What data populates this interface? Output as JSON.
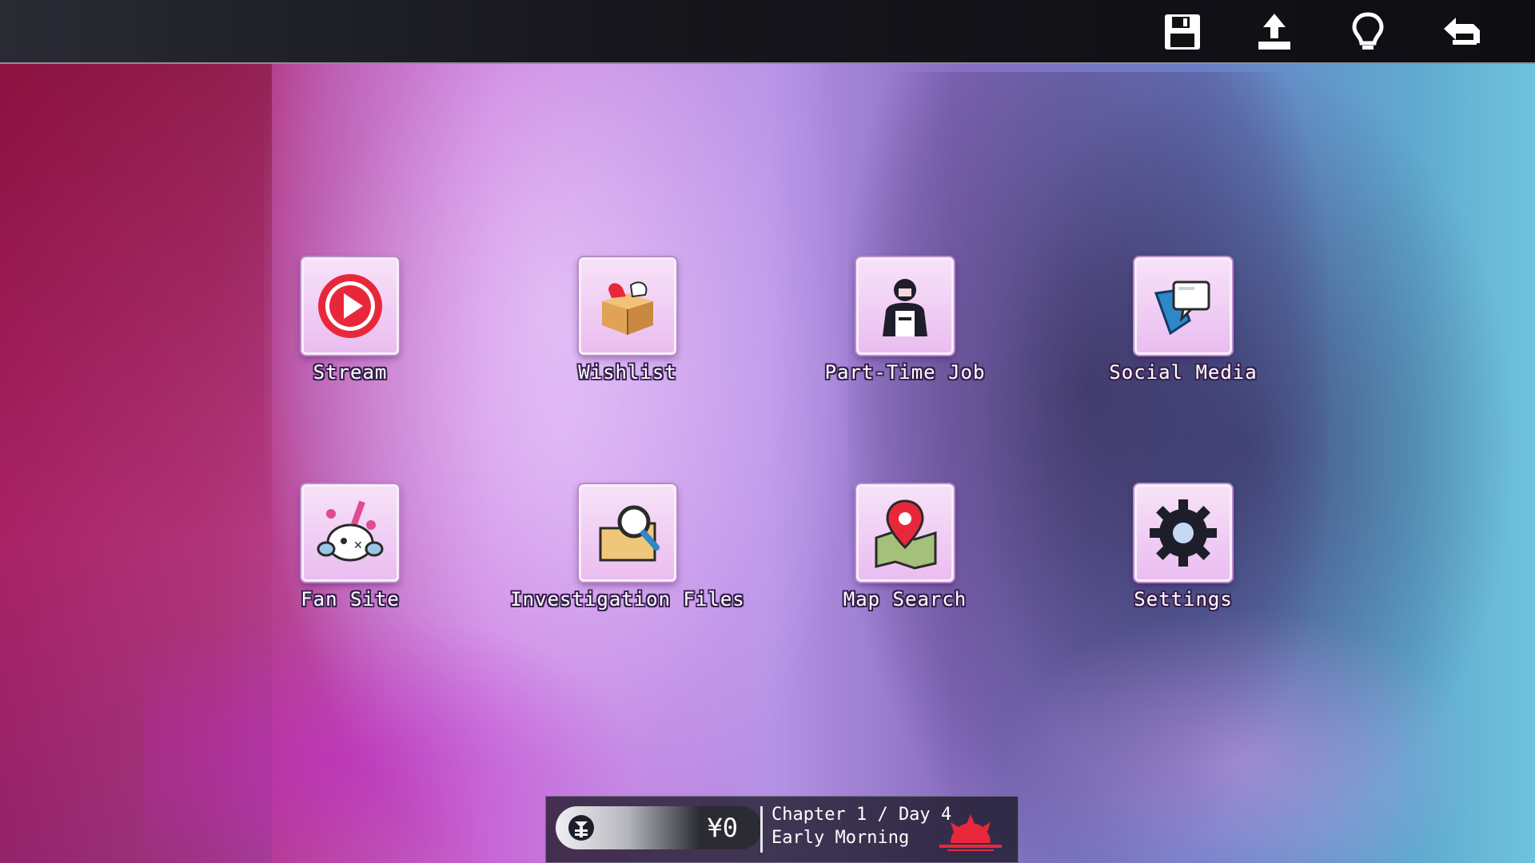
{
  "toolbar": {
    "buttons": [
      {
        "icon": "floppy-disk-icon"
      },
      {
        "icon": "upload-icon"
      },
      {
        "icon": "lightbulb-icon"
      },
      {
        "icon": "back-arrow-icon"
      }
    ]
  },
  "apps": [
    {
      "label": "Stream",
      "icon": "play-button-icon"
    },
    {
      "label": "Wishlist",
      "icon": "gift-box-icon"
    },
    {
      "label": "Part-Time Job",
      "icon": "worker-icon"
    },
    {
      "label": "Social Media",
      "icon": "chat-bubbles-icon"
    },
    {
      "label": "Fan Site",
      "icon": "fan-mascot-icon"
    },
    {
      "label": "Investigation Files",
      "icon": "magnifier-folder-icon"
    },
    {
      "label": "Map Search",
      "icon": "map-pin-icon"
    },
    {
      "label": "Settings",
      "icon": "gear-icon"
    }
  ],
  "status": {
    "money": "¥0",
    "chapter": "Chapter 1 / Day 4",
    "time_of_day": "Early Morning",
    "time_icon": "sunrise-icon"
  },
  "colors": {
    "tile_fill": "#eabdf0",
    "tile_border": "#f9eefb",
    "label_outline": "#3a2150",
    "sunrise_red": "#e8283a"
  }
}
